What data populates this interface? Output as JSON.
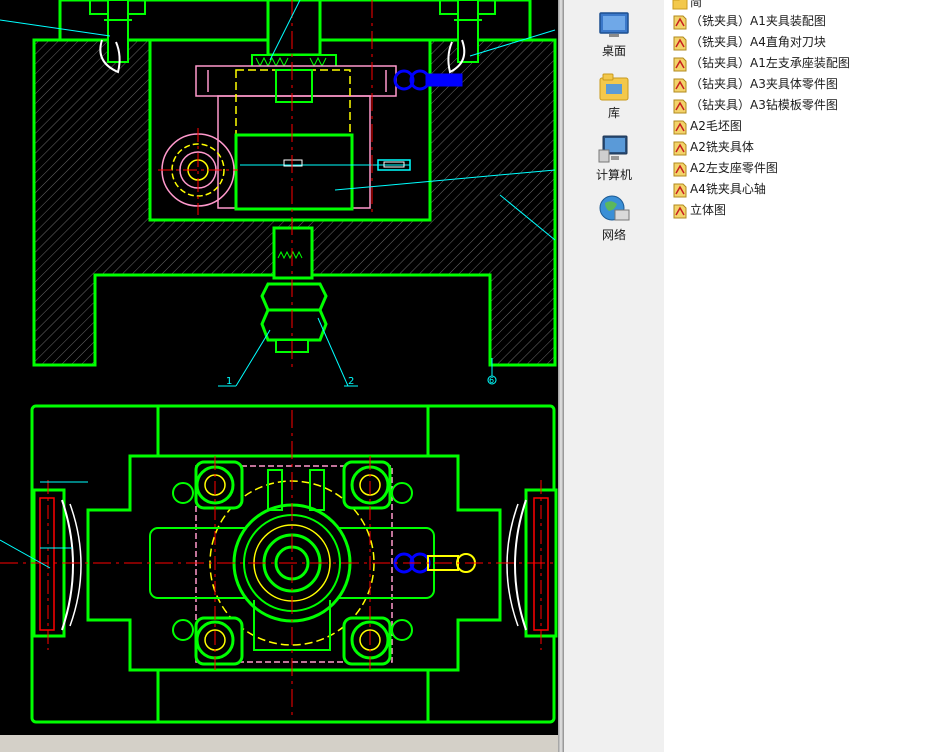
{
  "nav": {
    "items": [
      {
        "label": "桌面",
        "icon": "desktop-icon"
      },
      {
        "label": "库",
        "icon": "library-icon"
      },
      {
        "label": "计算机",
        "icon": "computer-icon"
      },
      {
        "label": "网络",
        "icon": "network-icon"
      }
    ]
  },
  "files": {
    "items": [
      {
        "label": "简",
        "icon": "folder-icon"
      },
      {
        "label": "（铣夹具）A1夹具装配图",
        "icon": "cad-file-icon"
      },
      {
        "label": "（铣夹具）A4直角对刀块",
        "icon": "cad-file-icon"
      },
      {
        "label": "（钻夹具）A1左支承座装配图",
        "icon": "cad-file-icon"
      },
      {
        "label": "（钻夹具）A3夹具体零件图",
        "icon": "cad-file-icon"
      },
      {
        "label": "（钻夹具）A3钻模板零件图",
        "icon": "cad-file-icon"
      },
      {
        "label": "A2毛坯图",
        "icon": "cad-file-icon"
      },
      {
        "label": "A2铣夹具体",
        "icon": "cad-file-icon"
      },
      {
        "label": "A2左支座零件图",
        "icon": "cad-file-icon"
      },
      {
        "label": "A4铣夹具心轴",
        "icon": "cad-file-icon"
      },
      {
        "label": "立体图",
        "icon": "cad-file-icon"
      }
    ]
  },
  "drawing": {
    "balloons": [
      "1",
      "2",
      "6"
    ]
  },
  "colors": {
    "cad_background": "#000000",
    "outline": "#00ff00",
    "centerline": "#ff0000",
    "hidden": "#ffff00",
    "leader": "#00ffff",
    "clamp": "#0000ff",
    "pink": "#ff99cc"
  }
}
